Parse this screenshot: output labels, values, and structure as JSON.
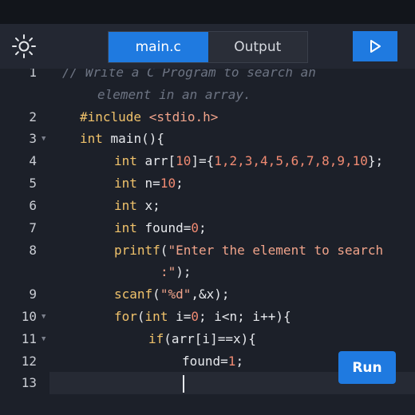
{
  "tabs": [
    {
      "label": "main.c",
      "active": true
    },
    {
      "label": "Output",
      "active": false
    }
  ],
  "icons": {
    "theme": "sun-icon",
    "run": "play-icon"
  },
  "colors": {
    "accent": "#1f7ae0",
    "background": "#1c2029",
    "keyword": "#f0c26b",
    "string": "#f0a38a",
    "number": "#f08a72",
    "comment": "#6d7483"
  },
  "editor": {
    "line_numbers": [
      "1",
      "2",
      "3",
      "4",
      "5",
      "6",
      "7",
      "8",
      "9",
      "10",
      "11",
      "12",
      "13"
    ],
    "lines": {
      "l1a": "// Write a C Program to search an",
      "l1b": "element in an array.",
      "l2_kw": "#include",
      "l2_str": "<stdio.h>",
      "l3_kw": "int",
      "l3_rest": " main(){",
      "l4_kw": "int",
      "l4_a": " arr[",
      "l4_n": "10",
      "l4_b": "]={",
      "l4_vals": "1,2,3,4,5,6,7,8,9,10",
      "l4_c": "};",
      "l5_kw": "int",
      "l5_a": " n=",
      "l5_n": "10",
      "l5_b": ";",
      "l6_kw": "int",
      "l6_a": " x;",
      "l7_kw": "int",
      "l7_a": " found=",
      "l7_n": "0",
      "l7_b": ";",
      "l8_fn": "printf",
      "l8_a": "(",
      "l8_str": "\"Enter the element to search",
      "l8_str2": ":\"",
      "l8_b": ");",
      "l9_fn": "scanf",
      "l9_a": "(",
      "l9_str": "\"%d\"",
      "l9_b": ",&x);",
      "l10_kw": "for",
      "l10_a": "(",
      "l10_kw2": "int",
      "l10_b": " i=",
      "l10_n": "0",
      "l10_c": "; i<n; i++){",
      "l11_kw": "if",
      "l11_a": "(arr[i]==x){",
      "l12_a": "found=",
      "l12_n": "1",
      "l12_b": ";"
    }
  },
  "run_button": {
    "label": "Run"
  }
}
